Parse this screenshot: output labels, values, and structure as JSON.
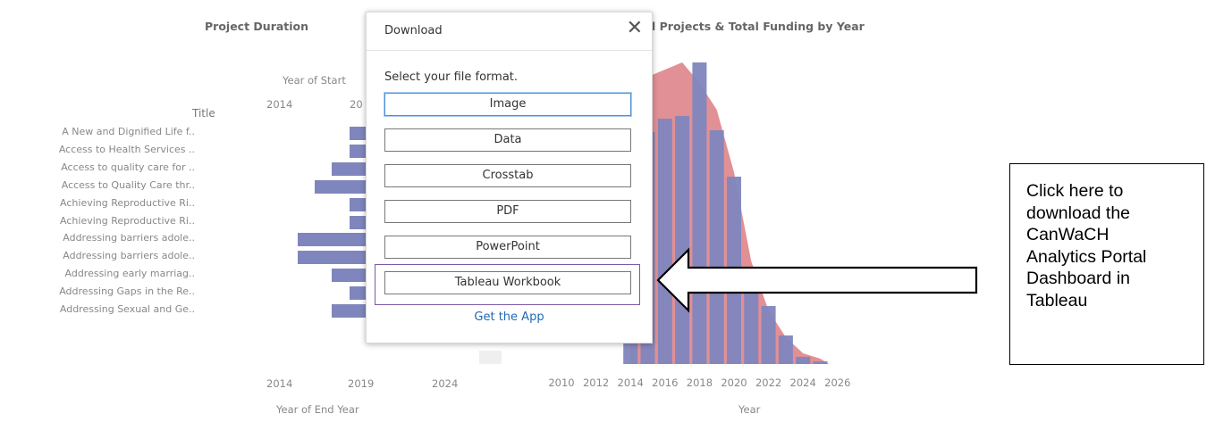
{
  "project_duration": {
    "title": "Project Duration",
    "top_axis_caption": "Year of Start",
    "top_ticks": [
      "2014",
      "20"
    ],
    "bottom_ticks": [
      "2014",
      "2019",
      "2024"
    ],
    "bottom_axis_caption": "Year of End Year",
    "column_header": "Title",
    "rows": [
      "A New and Dignified Life f..",
      "Access to Health Services ..",
      "Access to quality care for ..",
      "Access to Quality Care thr..",
      "Achieving Reproductive Ri..",
      "Achieving Reproductive Ri..",
      "Addressing barriers adole..",
      "Addressing barriers adole..",
      "Addressing early marriag..",
      "Addressing Gaps in the Re..",
      "Addressing Sexual and Ge.."
    ]
  },
  "funding_chart": {
    "title_fragment": "l Projects & Total Funding by Year",
    "x_caption": "Year",
    "x_ticks": [
      "2010",
      "2012",
      "2014",
      "2016",
      "2018",
      "2020",
      "2022",
      "2024",
      "2026"
    ]
  },
  "chart_data": {
    "type": "bar",
    "title": "l Projects & Total Funding by Year",
    "xlabel": "Year",
    "ylabel": "",
    "x": [
      2010,
      2011,
      2012,
      2013,
      2014,
      2015,
      2016,
      2017,
      2018,
      2019,
      2020,
      2021,
      2022,
      2023,
      2024,
      2025
    ],
    "series": [
      {
        "values": [
          null,
          null,
          null,
          null,
          230,
          260,
          275,
          278,
          338,
          262,
          210,
          105,
          65,
          32,
          8,
          3
        ]
      },
      {
        "values": [
          null,
          null,
          null,
          null,
          245,
          322,
          330,
          338,
          315,
          285,
          215,
          115,
          60,
          30,
          12,
          6
        ]
      }
    ],
    "colors": {
      "bars": "#7f86bd",
      "area": "#dc7c82"
    }
  },
  "dialog": {
    "title": "Download",
    "close_icon": "close-icon",
    "subtitle": "Select your file format.",
    "options": [
      {
        "label": "Image"
      },
      {
        "label": "Data"
      },
      {
        "label": "Crosstab"
      },
      {
        "label": "PDF"
      },
      {
        "label": "PowerPoint"
      },
      {
        "label": "Tableau Workbook"
      }
    ],
    "get_app": "Get the App"
  },
  "callout": {
    "lines": [
      "Click here to",
      "download the",
      "CanWaCH",
      "Analytics Portal",
      "Dashboard in",
      "Tableau"
    ]
  },
  "colors": {
    "accent": "#7b5aa6",
    "link": "#1f69b3"
  }
}
